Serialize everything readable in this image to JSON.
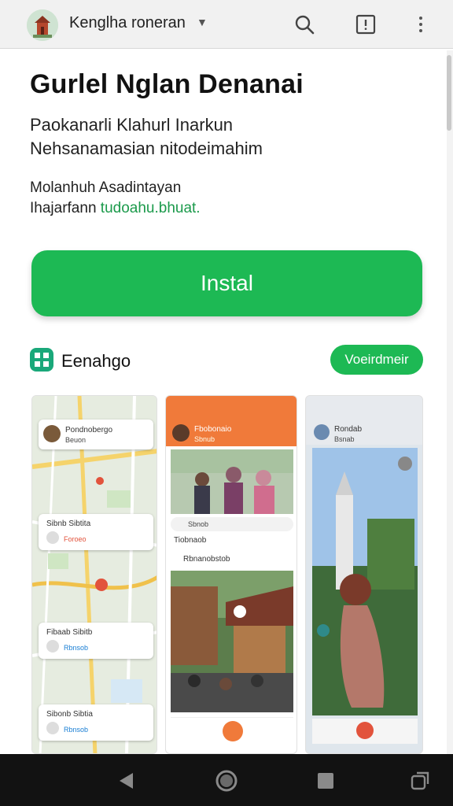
{
  "header": {
    "account_name": "Kenglha roneran",
    "icons": [
      "search-icon",
      "info-icon",
      "more-vert-icon",
      "chevron-down-icon"
    ]
  },
  "app": {
    "title": "Gurlel Nglan Denanai",
    "subtitle_line1": "Paokanarli Klahurl Inarkun",
    "subtitle_line2": "Nehsanamasian nitodeimahim",
    "meta_line1": "Molanhuh Asadintayan",
    "meta_line2_prefix": "Ihajarfann ",
    "meta_line2_accent": "tudoahu.bhuat.",
    "install_label": "Instal"
  },
  "section": {
    "label": "Eenahgo",
    "more_label": "Voeirdmeir"
  },
  "screenshots": {
    "shot1": {
      "top_card_title": "Pondnobergo",
      "top_card_sub": "Beuon",
      "card1_title": "Sibnb Sibtita",
      "card1_sub": "Foroeo",
      "card2_title": "Fibaab Sibitb",
      "card2_sub": "Rbnsob",
      "card3_title": "Sibonb Sibtia",
      "card3_sub": "Rbnsob"
    },
    "shot2": {
      "header_title": "Fbobonaio",
      "header_sub": "Sbnub",
      "row1": "Sbnob",
      "row2": "Tiobnaob",
      "row3": "Rbnanobstob"
    },
    "shot3": {
      "header_title": "Rondab",
      "header_sub": "Bsnab"
    }
  },
  "colors": {
    "accent": "#1db954",
    "map_orange": "#f08a3e",
    "header_orange": "#f07a3a"
  }
}
